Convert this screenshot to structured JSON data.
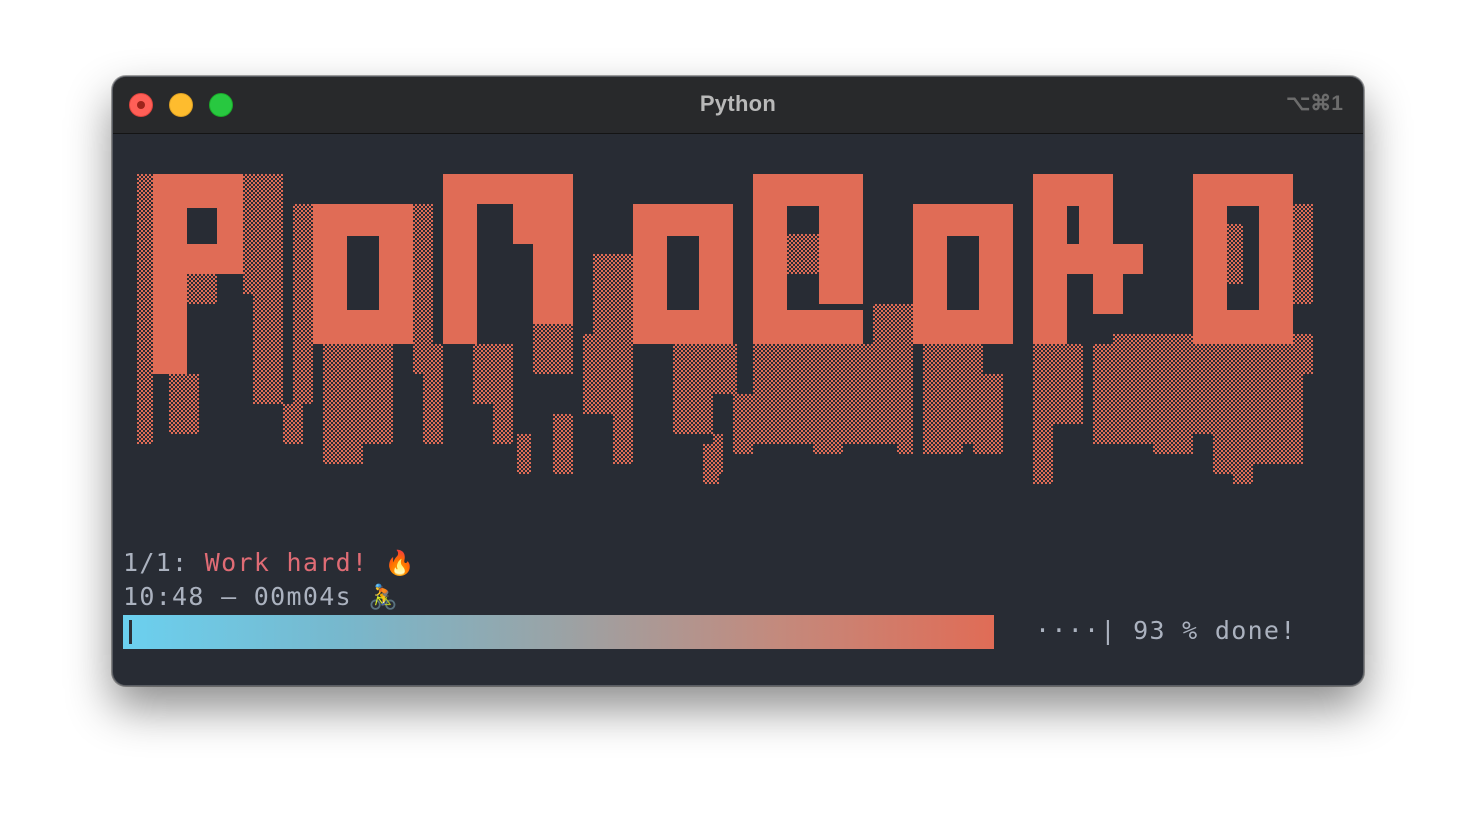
{
  "window": {
    "title": "Python",
    "shortcut": "⌥⌘1"
  },
  "banner": {
    "text": "POMODORO",
    "color": "#e06c56"
  },
  "status": {
    "counter": "1/1:",
    "message": "Work hard!",
    "message_icon": "fire-icon",
    "message_emoji": "🔥",
    "clock": "10:48 – 00m04s",
    "clock_icon": "cyclist-icon",
    "clock_emoji": "🚴"
  },
  "progress": {
    "percent": 93,
    "remaining_dots": "····|",
    "label": "93 % done!",
    "start_color": "#6bd0ef",
    "end_color": "#e06c56"
  }
}
